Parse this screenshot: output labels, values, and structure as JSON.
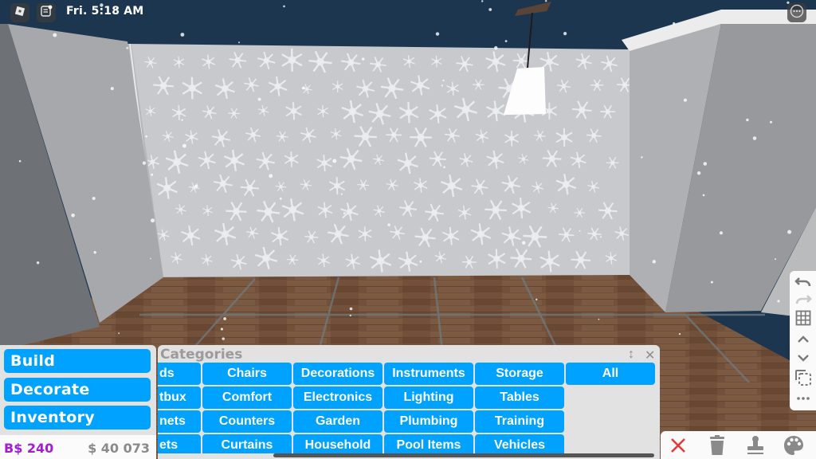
{
  "topbar": {
    "roblox_menu_icon": "roblox-logo-icon",
    "chat_icon": "chat-icon",
    "time": "Fri. 5:18 AM",
    "more_icon": "more-options-icon"
  },
  "left_menu": {
    "items": [
      {
        "label": "Build"
      },
      {
        "label": "Decorate"
      },
      {
        "label": "Inventory"
      }
    ],
    "bux_balance": "B$ 240",
    "cash_balance": "$ 40 073"
  },
  "categories": {
    "title": "Categories",
    "resize_icon": "↕",
    "close_icon": "✕",
    "columns": [
      [
        "ds",
        "tbux",
        "nets",
        "ets"
      ],
      [
        "Chairs",
        "Comfort",
        "Counters",
        "Curtains"
      ],
      [
        "Decorations",
        "Electronics",
        "Garden",
        "Household"
      ],
      [
        "Instruments",
        "Lighting",
        "Plumbing",
        "Pool Items"
      ],
      [
        "Storage",
        "Tables",
        "Training",
        "Vehicles"
      ],
      [
        "All"
      ]
    ]
  },
  "right_toolbar": {
    "items": [
      "undo-icon",
      "redo-icon",
      "grid-icon",
      "move-up-icon",
      "move-down-icon",
      "select-icon",
      "more-icon"
    ]
  },
  "bottom_toolbar": {
    "items": [
      "close-icon",
      "trash-icon",
      "stamp-icon",
      "palette-icon"
    ],
    "close_color": "#e53935",
    "icon_color": "#8a8a8a"
  },
  "colors": {
    "accent": "#00a2ff",
    "bux": "#a51ad6",
    "cash": "#8a8a8a",
    "panel": "#e2e2e2"
  }
}
